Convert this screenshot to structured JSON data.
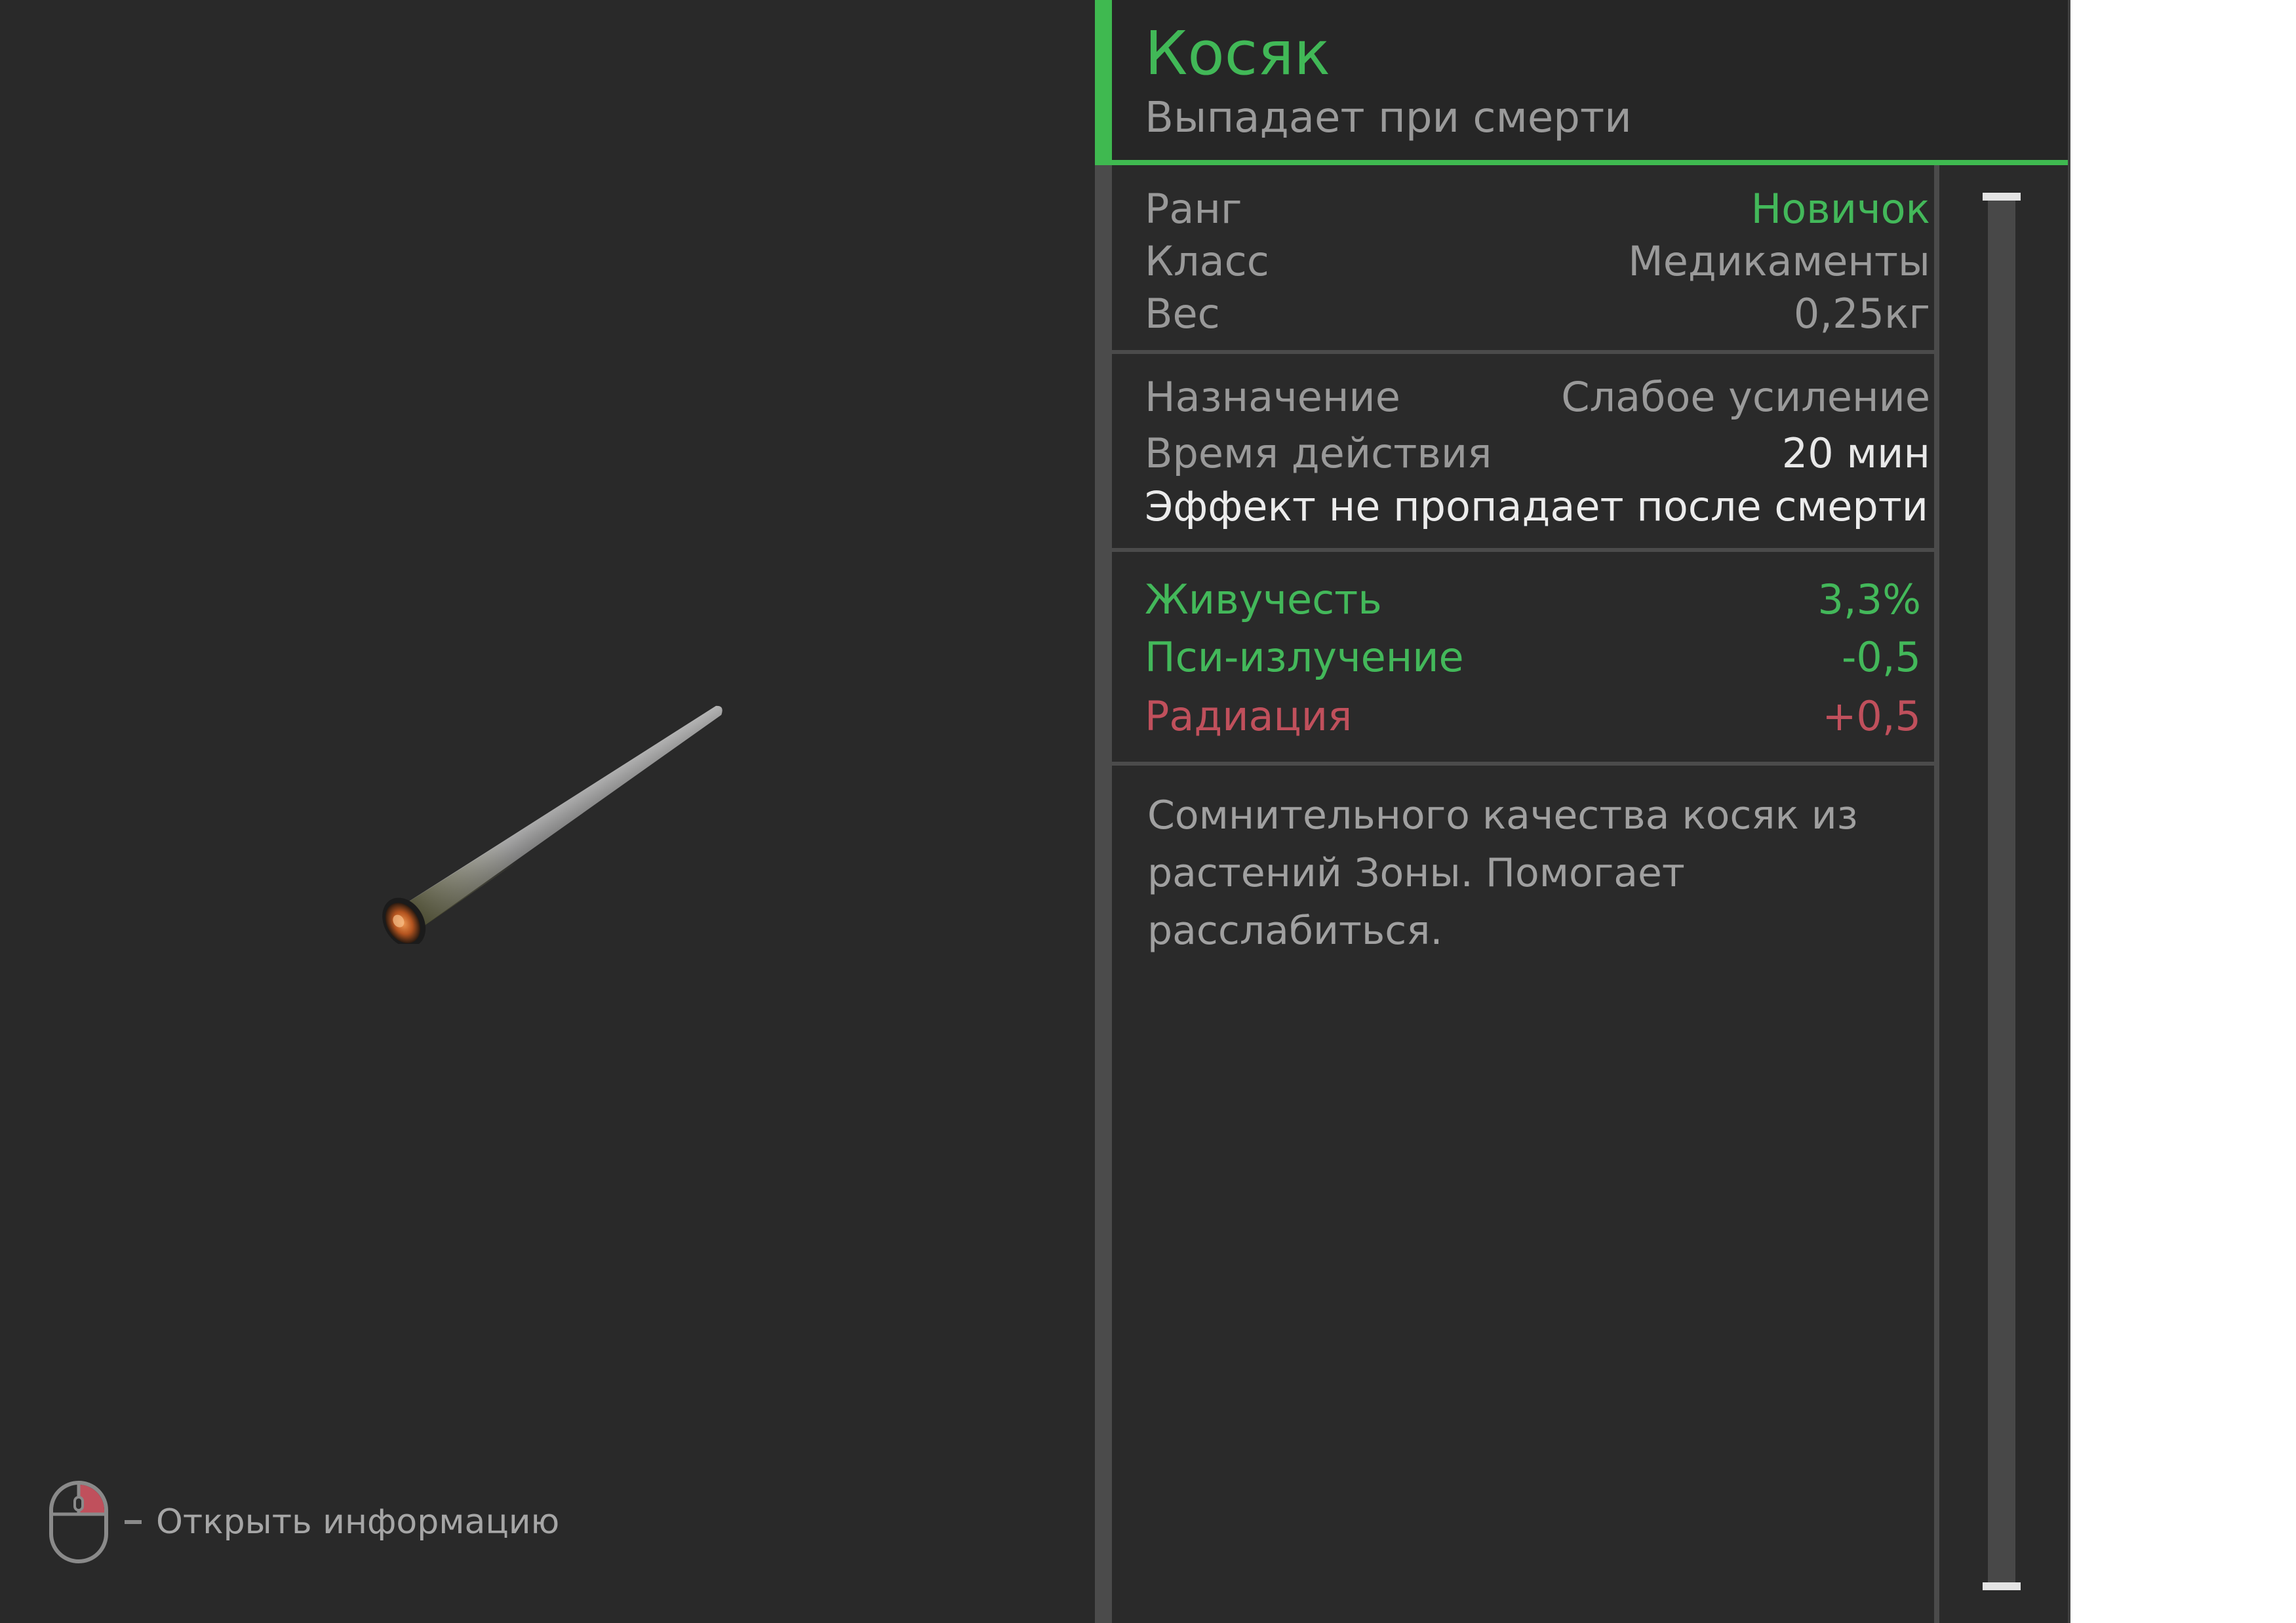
{
  "item": {
    "title": "Косяк",
    "subtitle": "Выпадает при смерти",
    "image_icon": "joint-cigarette-icon"
  },
  "hint": {
    "icon": "mouse-right-click-icon",
    "text": "Открыть информацию"
  },
  "basic_stats": {
    "rank_label": "Ранг",
    "rank_value": "Новичок",
    "class_label": "Класс",
    "class_value": "Медикаменты",
    "weight_label": "Вес",
    "weight_value": "0,25кг"
  },
  "usage": {
    "purpose_label": "Назначение",
    "purpose_value": "Слабое усиление",
    "duration_label": "Время действия",
    "duration_value": "20 мин",
    "note": "Эффект не пропадает после смерти"
  },
  "effects": [
    {
      "label": "Живучесть",
      "value": "3,3%",
      "tone": "positive"
    },
    {
      "label": "Пси-излучение",
      "value": "-0,5",
      "tone": "positive"
    },
    {
      "label": "Радиация",
      "value": "+0,5",
      "tone": "negative"
    }
  ],
  "description": {
    "line1": "Сомнительного качества косяк из",
    "line2": "растений Зоны. Помогает расслабиться."
  },
  "colors": {
    "accent_green": "#3fb950",
    "positive": "#43b85a",
    "negative": "#c0505c",
    "panel_bg": "#2a2a2a"
  }
}
